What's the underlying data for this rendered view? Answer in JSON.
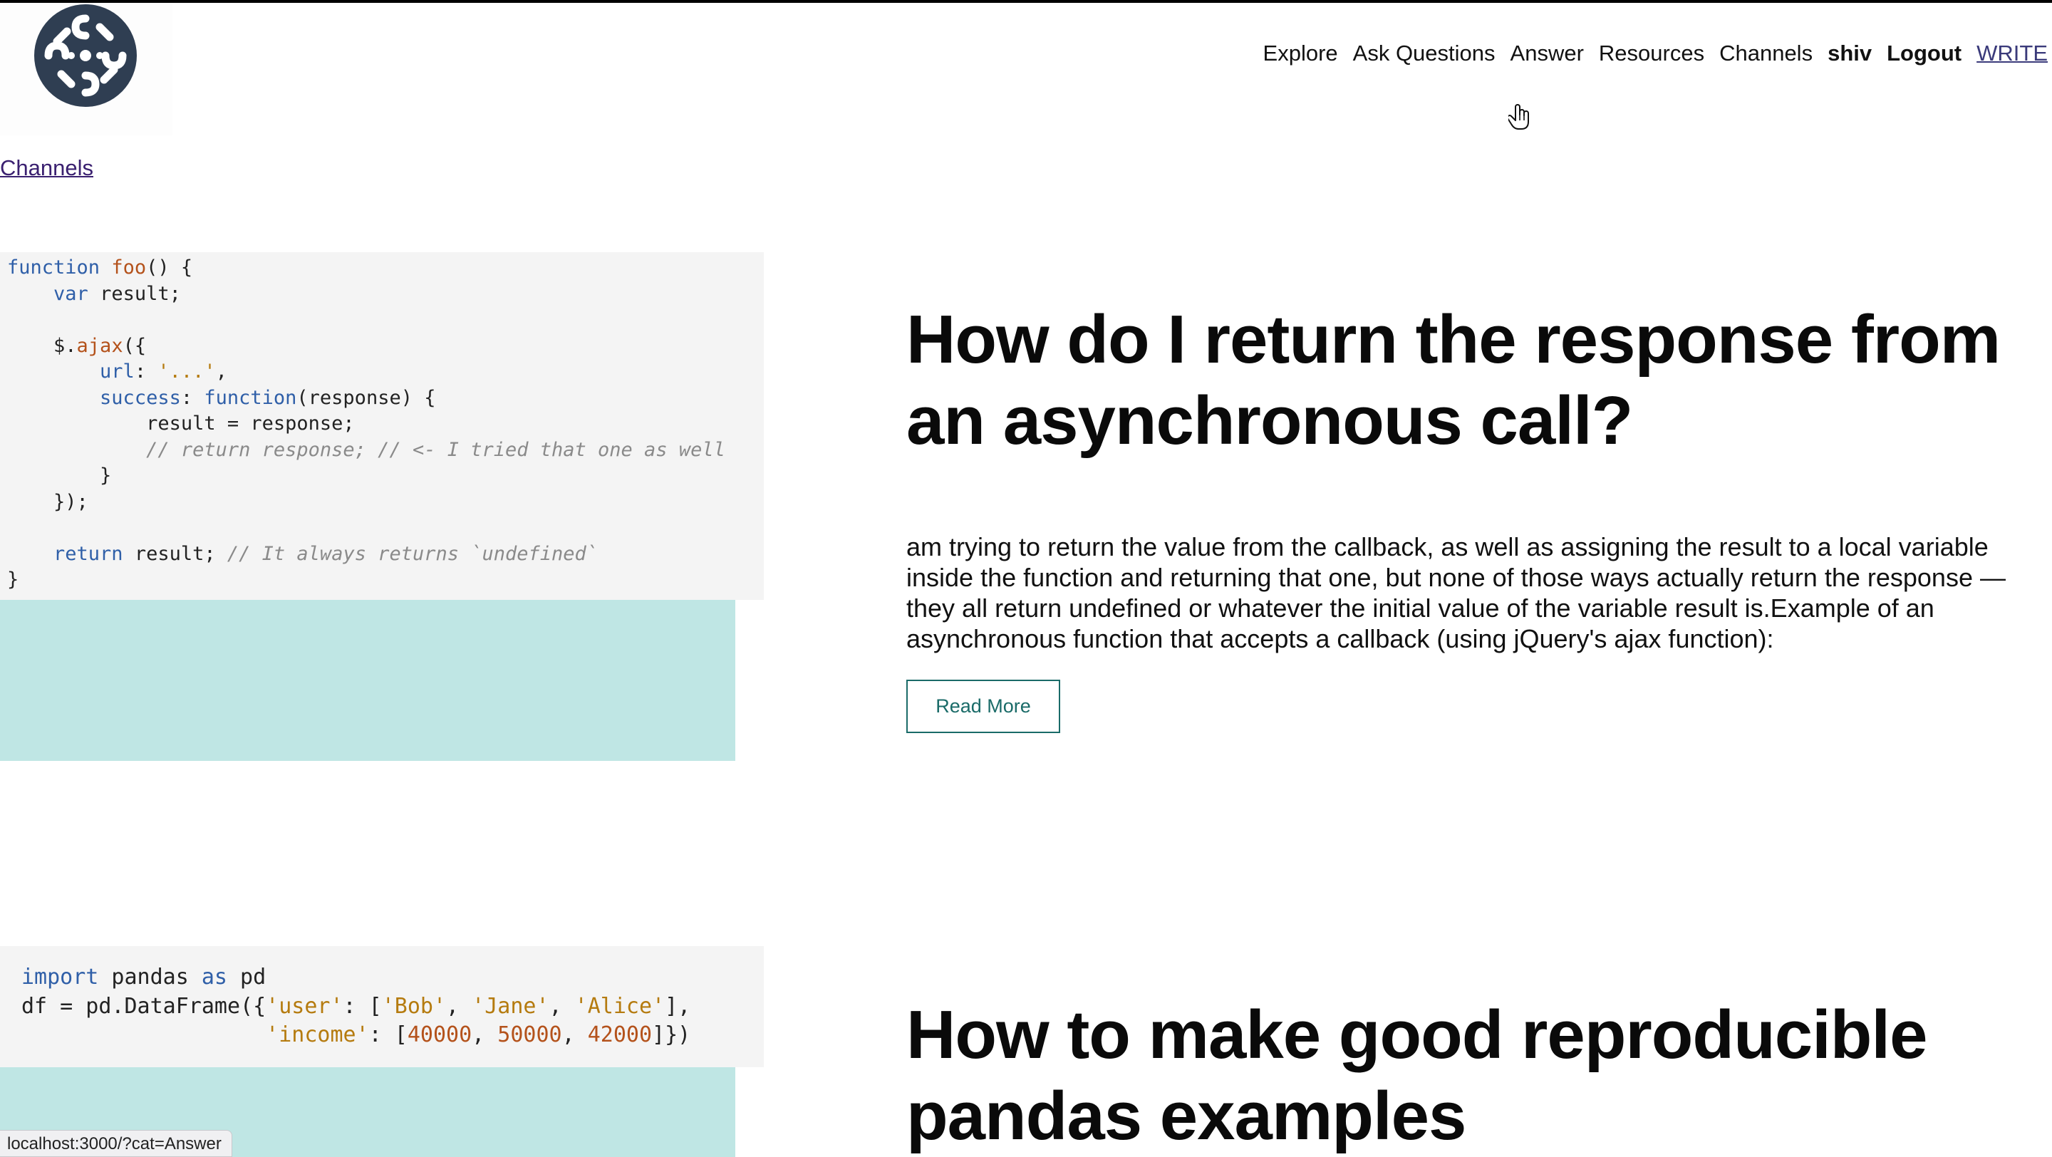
{
  "nav": {
    "items": [
      "Explore",
      "Ask Questions",
      "Answer",
      "Resources",
      "Channels"
    ],
    "user": "shiv",
    "logout": "Logout",
    "write": "WRITE",
    "logo_icon": "brand-logo-icon",
    "logo_colors": {
      "bg": "#2f3e52",
      "fg": "#ffffff"
    }
  },
  "breadcrumb": {
    "channels": "Channels"
  },
  "articles": [
    {
      "title": "How do I return the response from an asynchronous call?",
      "excerpt": "am trying to return the value from the callback, as well as assigning the result to a local variable inside the function and returning that one, but none of those ways actually return the response — they all return undefined or whatever the initial value of the variable result is.Example of an asynchronous function that accepts a callback (using jQuery's ajax function):",
      "read_more": "Read More",
      "code_lines": [
        "function foo() {",
        "    var result;",
        "",
        "    $.ajax({",
        "        url: '...',",
        "        success: function(response) {",
        "            result = response;",
        "            // return response; // <- I tried that one as well",
        "        }",
        "    });",
        "",
        "    return result; // It always returns `undefined`",
        "}"
      ]
    },
    {
      "title": "How to make good reproducible pandas examples",
      "code_lines": [
        "import pandas as pd",
        "df = pd.DataFrame({'user': ['Bob', 'Jane', 'Alice'],",
        "                   'income': [40000, 50000, 42000]})"
      ]
    }
  ],
  "status_bar": {
    "url": "localhost:3000/?cat=Answer"
  },
  "colors": {
    "accent_teal": "#bfe6e4",
    "button_border": "#1a6b68",
    "code_bg": "#f4f4f4"
  }
}
